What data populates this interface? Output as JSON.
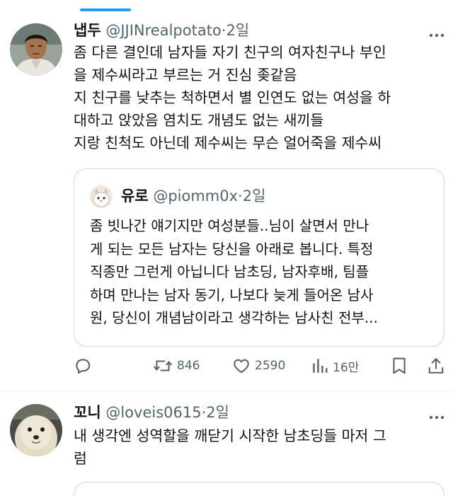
{
  "tweets": [
    {
      "name": "냅두",
      "handle": "@JJINrealpotato",
      "separator": "·",
      "time": "2일",
      "text": "좀 다른 결인데 남자들 자기 친구의 여자친구나 부인\n을 제수씨라고 부르는 거 진심 좆같음\n지 친구를 낮추는 척하면서 별 인연도 없는 여성을 하\n대하고 앉았음 염치도 개념도 없는 새끼들\n지랑 친척도 아닌데 제수씨는 무슨 얼어죽을 제수씨",
      "more_icon": "more-horizontal-icon",
      "quoted": {
        "name": "유로",
        "handle": "@piomm0x",
        "separator": "·",
        "time": "2일",
        "text": "좀 빗나간 얘기지만 여성분들..님이 살면서 만나\n게 되는 모든 남자는 당신을 아래로 봅니다. 특정\n직종만 그런게 아닙니다 남초딩, 남자후배, 팀플\n하며 만나는 남자 동기, 나보다 늦게 들어온 남사\n원, 당신이 개념남이라고 생각하는 남사친 전부..."
      },
      "actions": {
        "reply_icon": "reply-icon",
        "retweet_icon": "retweet-icon",
        "retweets": "846",
        "like_icon": "heart-icon",
        "likes": "2590",
        "views_icon": "views-icon",
        "views": "16만",
        "bookmark_icon": "bookmark-icon",
        "share_icon": "share-icon"
      }
    },
    {
      "name": "꼬니",
      "handle": "@loveis0615",
      "separator": "·",
      "time": "2일",
      "text": "내 생각엔 성역할을 깨닫기 시작한 남초딩들 마저 그\n럼",
      "more_icon": "more-horizontal-icon"
    }
  ],
  "colors": {
    "accent": "#1d9bf0",
    "text_primary": "#0f1419",
    "text_secondary": "#536471",
    "border": "#cfd9de"
  }
}
